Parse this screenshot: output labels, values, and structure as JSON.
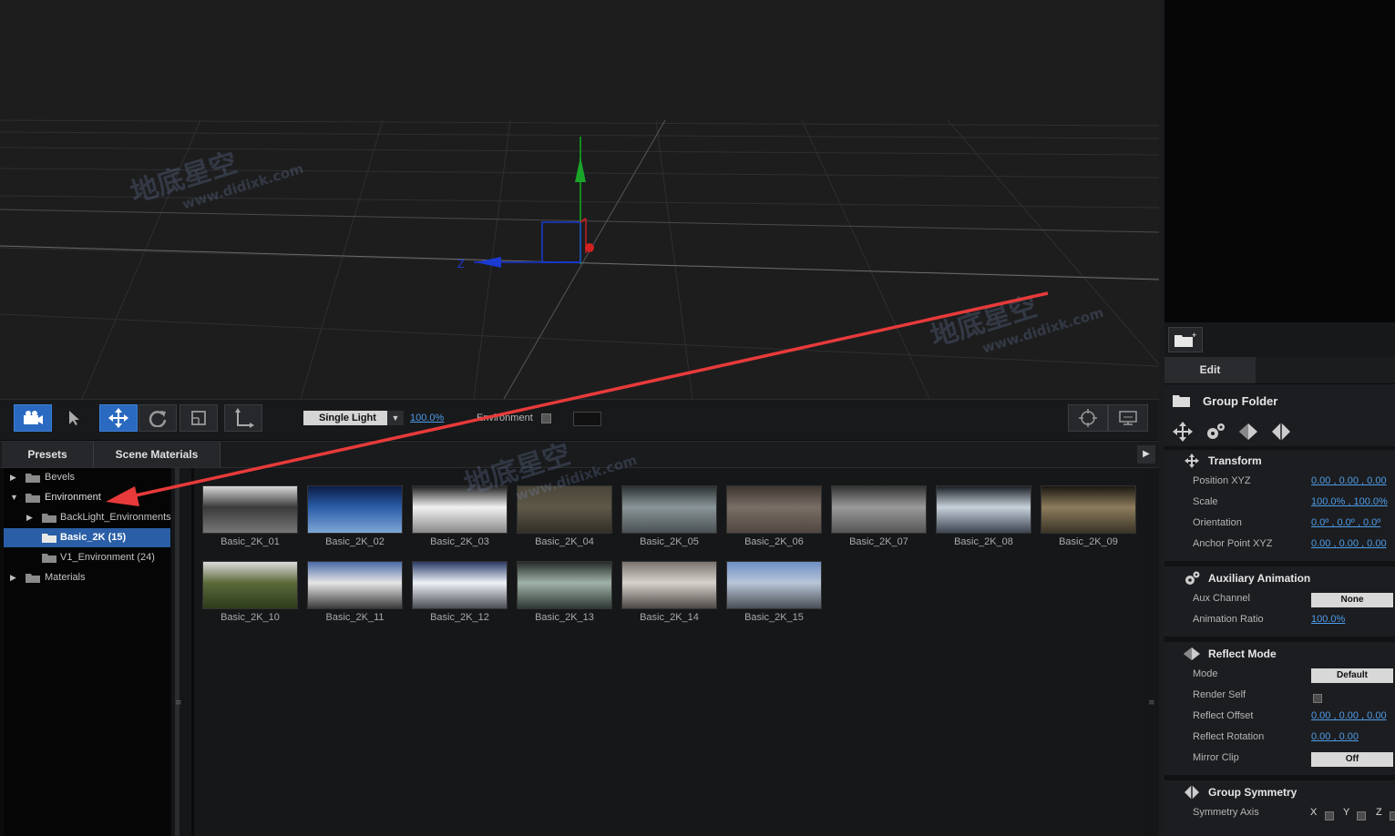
{
  "toolbar": {
    "light_mode": "Single Light",
    "light_percent": "100.0%",
    "environment_label": "Environment"
  },
  "preset_tabs": [
    "Presets",
    "Scene Materials"
  ],
  "tree": [
    {
      "label": "Bevels",
      "expanded": false
    },
    {
      "label": "Environment",
      "expanded": true
    },
    {
      "label": "BackLight_Environments",
      "expanded": false
    },
    {
      "label": "Basic_2K (15)",
      "selected": true
    },
    {
      "label": "V1_Environment (24)"
    },
    {
      "label": "Materials",
      "expanded": false
    }
  ],
  "thumbnails": [
    {
      "label": "Basic_2K_01",
      "colors": [
        "#d8d8d8",
        "#3a3a3a",
        "#777"
      ]
    },
    {
      "label": "Basic_2K_02",
      "colors": [
        "#0c1d46",
        "#2a5da8",
        "#7fa7d6"
      ]
    },
    {
      "label": "Basic_2K_03",
      "colors": [
        "#222",
        "#f2f2f2",
        "#888"
      ]
    },
    {
      "label": "Basic_2K_04",
      "colors": [
        "#4a4538",
        "#5e5848",
        "#332f27"
      ]
    },
    {
      "label": "Basic_2K_05",
      "colors": [
        "#2b3133",
        "#8a9598",
        "#4a5154"
      ]
    },
    {
      "label": "Basic_2K_06",
      "colors": [
        "#3d3630",
        "#7a6e66",
        "#504740"
      ]
    },
    {
      "label": "Basic_2K_07",
      "colors": [
        "#333",
        "#9a9a9a",
        "#555"
      ]
    },
    {
      "label": "Basic_2K_08",
      "colors": [
        "#1a1e24",
        "#c8d2dc",
        "#3d4650"
      ]
    },
    {
      "label": "Basic_2K_09",
      "colors": [
        "#1a1712",
        "#8c7c5c",
        "#3b3427"
      ]
    },
    {
      "label": "Basic_2K_10",
      "colors": [
        "#dcdcdc",
        "#5b6a3a",
        "#2d3b1c"
      ]
    },
    {
      "label": "Basic_2K_11",
      "colors": [
        "#4a6aa8",
        "#e6e6e6",
        "#3b3b3b"
      ]
    },
    {
      "label": "Basic_2K_12",
      "colors": [
        "#2a3a66",
        "#eef2f8",
        "#4a4e55"
      ]
    },
    {
      "label": "Basic_2K_13",
      "colors": [
        "#252a28",
        "#9fb3a8",
        "#2f3835"
      ]
    },
    {
      "label": "Basic_2K_14",
      "colors": [
        "#7a7570",
        "#d6d2cc",
        "#4d4945"
      ]
    },
    {
      "label": "Basic_2K_15",
      "colors": [
        "#6f8fc4",
        "#b9c6d8",
        "#4a4f58"
      ]
    }
  ],
  "right_panel": {
    "tab": "Edit",
    "object_title": "Group Folder",
    "transform": {
      "title": "Transform",
      "rows": [
        {
          "label": "Position XYZ",
          "value": "0.00 ,  0.00 ,  0.00"
        },
        {
          "label": "Scale",
          "value": "100.0% ,  100.0%"
        },
        {
          "label": "Orientation",
          "value": "0.0º ,  0.0º ,  0.0º"
        },
        {
          "label": "Anchor Point XYZ",
          "value": "0.00 ,  0.00 ,  0.00"
        }
      ]
    },
    "aux": {
      "title": "Auxiliary Animation",
      "channel_label": "Aux Channel",
      "channel_value": "None",
      "ratio_label": "Animation Ratio",
      "ratio_value": "100.0%"
    },
    "reflect": {
      "title": "Reflect Mode",
      "mode_label": "Mode",
      "mode_value": "Default",
      "render_self_label": "Render Self",
      "offset_label": "Reflect Offset",
      "offset_value": "0.00 ,  0.00 ,  0.00",
      "rotation_label": "Reflect Rotation",
      "rotation_value": "0.00 ,  0.00",
      "mirror_label": "Mirror Clip",
      "mirror_value": "Off"
    },
    "symmetry": {
      "title": "Group Symmetry",
      "axis_label": "Symmetry Axis",
      "axes": [
        "X",
        "Y",
        "Z"
      ]
    }
  },
  "watermark": {
    "cn": "地底星空",
    "url": "www.didixk.com"
  },
  "gizmo_axis_label": "Z",
  "colors": {
    "accent": "#2a5ea6",
    "annotation_arrow": "#e83a3a",
    "link": "#4f9de8"
  }
}
